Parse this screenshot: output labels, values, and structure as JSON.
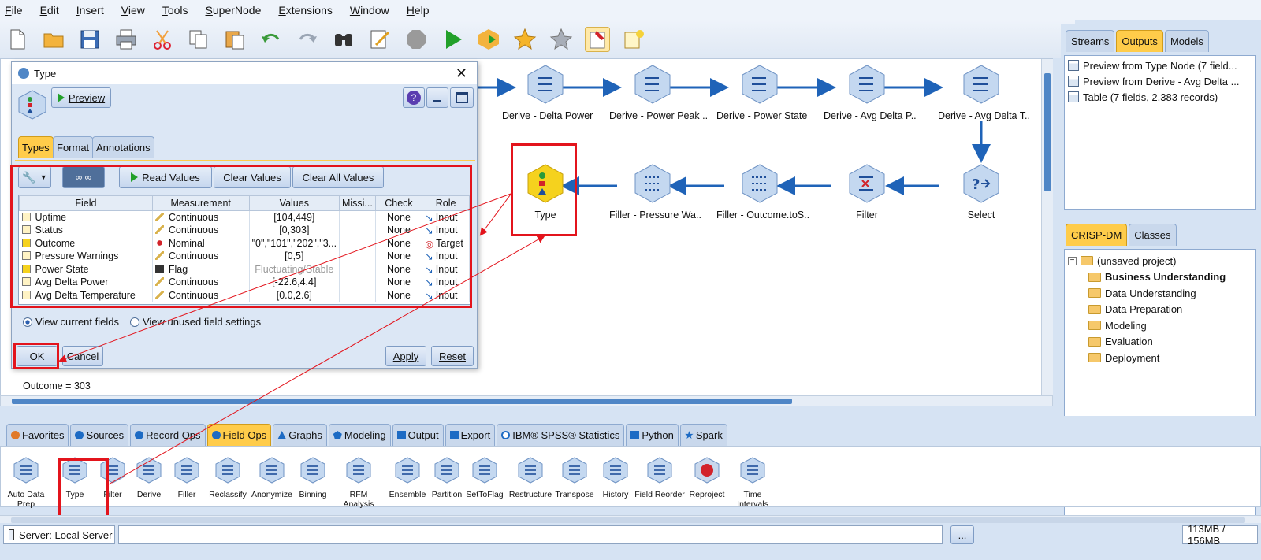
{
  "menu": [
    "File",
    "Edit",
    "Insert",
    "View",
    "Tools",
    "SuperNode",
    "Extensions",
    "Window",
    "Help"
  ],
  "toolbar_icons": [
    "new-file-icon",
    "open-folder-icon",
    "save-icon",
    "print-icon",
    "cut-icon",
    "copy-icon",
    "paste-icon",
    "undo-icon",
    "redo-icon",
    "search-binoculars-icon",
    "edit-icon",
    "stop-icon",
    "run-icon",
    "run-selection-icon",
    "star-icon",
    "star-outline-icon",
    "pin-icon",
    "annotation-icon"
  ],
  "stream": {
    "row1": [
      "Derive - Delta Power",
      "Derive - Power Peak ..",
      "Derive - Power State",
      "Derive - Avg Delta P..",
      "Derive - Avg Delta T.."
    ],
    "row2": [
      "Type",
      "Filler - Pressure Wa..",
      "Filler - Outcome.toS..",
      "Filter",
      "Select"
    ],
    "comment": "Outcome = 303"
  },
  "right_top": {
    "tabs": [
      "Streams",
      "Outputs",
      "Models"
    ],
    "items": [
      "Preview from Type Node (7 field...",
      "Preview from Derive - Avg Delta ...",
      "Table (7 fields, 2,383 records)"
    ]
  },
  "right_bottom": {
    "tabs": [
      "CRISP-DM",
      "Classes"
    ],
    "root": "(unsaved project)",
    "items": [
      "Business Understanding",
      "Data Understanding",
      "Data Preparation",
      "Modeling",
      "Evaluation",
      "Deployment"
    ]
  },
  "dialog": {
    "title": "Type",
    "preview": "Preview",
    "tabs": [
      "Types",
      "Format",
      "Annotations"
    ],
    "buttons": {
      "read": "Read Values",
      "clear": "Clear Values",
      "clear_all": "Clear All Values",
      "ok": "OK",
      "cancel": "Cancel",
      "apply": "Apply",
      "reset": "Reset"
    },
    "columns": [
      "Field",
      "Measurement",
      "Values",
      "Missi...",
      "Check",
      "Role"
    ],
    "rows": [
      [
        "Uptime",
        "Continuous",
        "[104,449]",
        "",
        "None",
        "Input"
      ],
      [
        "Status",
        "Continuous",
        "[0,303]",
        "",
        "None",
        "Input"
      ],
      [
        "Outcome",
        "Nominal",
        "\"0\",\"101\",\"202\",\"3...",
        "",
        "None",
        "Target"
      ],
      [
        "Pressure Warnings",
        "Continuous",
        "[0,5]",
        "",
        "None",
        "Input"
      ],
      [
        "Power State",
        "Flag",
        "Fluctuating/Stable",
        "",
        "None",
        "Input"
      ],
      [
        "Avg Delta Power",
        "Continuous",
        "[-22.6,4.4]",
        "",
        "None",
        "Input"
      ],
      [
        "Avg Delta Temperature",
        "Continuous",
        "[0.0,2.6]",
        "",
        "None",
        "Input"
      ]
    ],
    "radio1": "View current fields",
    "radio2": "View unused field settings"
  },
  "palette_tabs": [
    "Favorites",
    "Sources",
    "Record Ops",
    "Field Ops",
    "Graphs",
    "Modeling",
    "Output",
    "Export",
    "IBM® SPSS® Statistics",
    "Python",
    "Spark"
  ],
  "palette_nodes": [
    "Auto Data Prep",
    "Type",
    "Filter",
    "Derive",
    "Filler",
    "Reclassify",
    "Anonymize",
    "Binning",
    "RFM Analysis",
    "Ensemble",
    "Partition",
    "SetToFlag",
    "Restructure",
    "Transpose",
    "History",
    "Field Reorder",
    "Reproject",
    "Time Intervals"
  ],
  "status": {
    "server": "Server: Local Server",
    "more": "...",
    "memory": "113MB / 156MB"
  }
}
